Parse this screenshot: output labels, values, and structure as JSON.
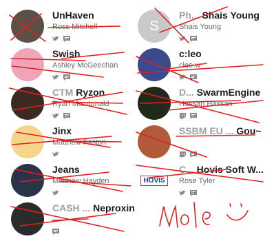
{
  "creators": [
    {
      "tag": "",
      "name": "UnHaven",
      "sub": "Ross Mitchell",
      "icons": [
        "twitter-icon",
        "chat-icon"
      ],
      "avatar_color": "#5b4f47"
    },
    {
      "tag": "Ph...",
      "name": "Shais Young",
      "sub": "Shais Young",
      "icons": [
        "twitter-icon",
        "chat-icon"
      ],
      "avatar_color": "#c9c9c9",
      "initial": "S"
    },
    {
      "tag": "",
      "name": "Swish",
      "sub": "Ashley McGeechan",
      "icons": [
        "twitter-icon",
        "chat-icon"
      ],
      "avatar_color": "#f1a3b7"
    },
    {
      "tag": "",
      "name": "c:leo",
      "sub": "cleo w",
      "icons": [
        "twitter-icon",
        "chat-icon"
      ],
      "avatar_color": "#3b4a8c"
    },
    {
      "tag": "CTM",
      "name": "Ryzon",
      "sub": "Ryan Macdonald",
      "icons": [
        "twitter-icon",
        "chat-icon"
      ],
      "avatar_color": "#3a2a22"
    },
    {
      "tag": "D...",
      "name": "SwarmEngine",
      "sub": "Hassan Hassan",
      "icons": [
        "twitch-icon",
        "chat-icon"
      ],
      "avatar_color": "#1f2a1b"
    },
    {
      "tag": "",
      "name": "Jinx",
      "sub": "Matthew Faston",
      "icons": [
        "twitter-icon"
      ],
      "avatar_color": "#f4d58a"
    },
    {
      "tag": "SSBM EU ...",
      "name": "Gou~",
      "sub": "",
      "icons": [
        "twitch-icon",
        "chat-icon"
      ],
      "avatar_color": "#b25b3a"
    },
    {
      "tag": "",
      "name": "Jeans",
      "sub": "Matthew Hayden",
      "icons": [
        "twitter-icon"
      ],
      "avatar_color": "#2a3347"
    },
    {
      "tag": "C...",
      "name": "Hovis Soft W...",
      "sub": "Rose Tyler",
      "icons": [
        "twitter-icon",
        "chat-icon"
      ],
      "avatar_color": "#ffffff",
      "avatar_text": "HOVIS"
    },
    {
      "tag": "CASH ...",
      "name": "Neproxin",
      "sub": "",
      "icons": [
        "chat-icon"
      ],
      "avatar_color": "#2b2b2b"
    }
  ],
  "handwriting": "Mole :)",
  "colors": {
    "ink": "#e02020",
    "icon": "#8a8a8a"
  }
}
